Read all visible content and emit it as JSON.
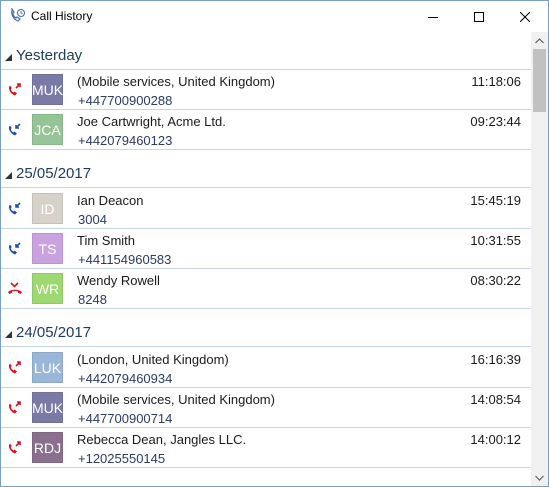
{
  "window": {
    "title": "Call History"
  },
  "colors": {
    "missed_call": "#d9121d",
    "incoming_call": "#1f4fa8",
    "header_text": "#1e3a5f",
    "separator": "#c7d6e6"
  },
  "groups": [
    {
      "header": "Yesterday",
      "rows": [
        {
          "call_type": "missed",
          "icon": "missed-call-icon",
          "initials": "MUK",
          "avatar_color": "#7a7aa6",
          "name": "(Mobile services, United Kingdom)",
          "number": "+447700900288",
          "time": "11:18:06"
        },
        {
          "call_type": "incoming",
          "icon": "incoming-call-icon",
          "initials": "JCA",
          "avatar_color": "#95c497",
          "name": "Joe Cartwright, Acme Ltd.",
          "number": "+442079460123",
          "time": "09:23:44"
        }
      ]
    },
    {
      "header": "25/05/2017",
      "rows": [
        {
          "call_type": "incoming",
          "icon": "incoming-call-icon",
          "initials": "ID",
          "avatar_color": "#d6d1c9",
          "name": "Ian Deacon",
          "number": "3004",
          "time": "15:45:19"
        },
        {
          "call_type": "incoming",
          "icon": "incoming-call-icon",
          "initials": "TS",
          "avatar_color": "#c9a3e0",
          "name": "Tim Smith",
          "number": "+441154960583",
          "time": "10:31:55"
        },
        {
          "call_type": "rejected",
          "icon": "rejected-call-icon",
          "initials": "WR",
          "avatar_color": "#9ed870",
          "name": "Wendy Rowell",
          "number": "8248",
          "time": "08:30:22"
        }
      ]
    },
    {
      "header": "24/05/2017",
      "rows": [
        {
          "call_type": "missed",
          "icon": "missed-call-icon",
          "initials": "LUK",
          "avatar_color": "#9ab6d8",
          "name": "(London, United Kingdom)",
          "number": "+442079460934",
          "time": "16:16:39"
        },
        {
          "call_type": "missed",
          "icon": "missed-call-icon",
          "initials": "MUK",
          "avatar_color": "#7a7aa6",
          "name": "(Mobile services, United Kingdom)",
          "number": "+447700900714",
          "time": "14:08:54"
        },
        {
          "call_type": "missed",
          "icon": "missed-call-icon",
          "initials": "RDJ",
          "avatar_color": "#8a6f8f",
          "name": "Rebecca Dean, Jangles LLC.",
          "number": "+12025550145",
          "time": "14:00:12"
        }
      ]
    }
  ]
}
